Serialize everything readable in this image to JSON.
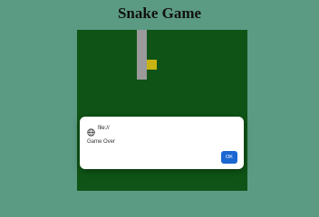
{
  "page": {
    "title": "Snake Game"
  },
  "game": {
    "board_color": "#0f5416",
    "snake_color": "#9a9a9a",
    "food_color": "#c9b312"
  },
  "dialog": {
    "origin": "file://",
    "message": "Game Over",
    "ok_label": "OK",
    "origin_icon": "globe-icon"
  }
}
